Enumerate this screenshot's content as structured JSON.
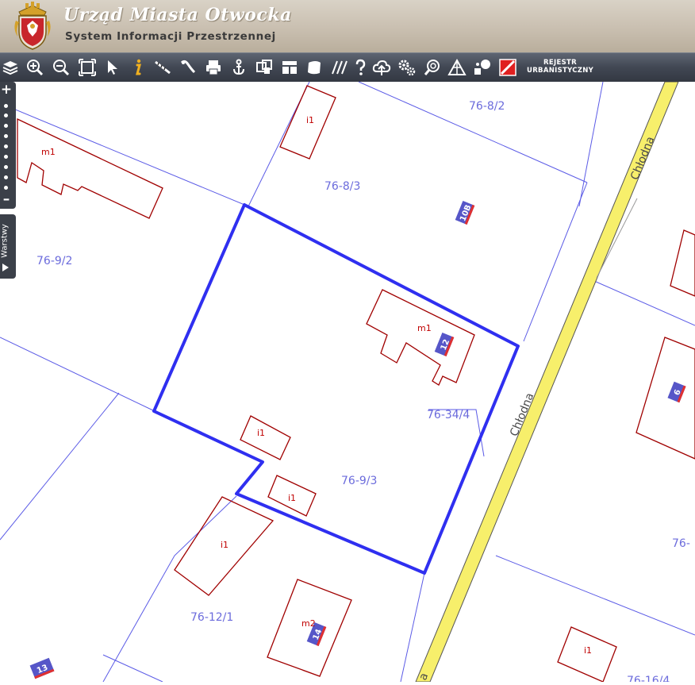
{
  "header": {
    "title": "Urząd Miasta Otwocka",
    "subtitle": "System Informacji Przestrzennej"
  },
  "toolbar": {
    "icons": [
      "layers-icon",
      "zoom-in-icon",
      "zoom-out-icon",
      "full-extent-icon",
      "select-arrow-icon",
      "info-icon",
      "measure-distance-icon",
      "measure-area-icon",
      "print-icon",
      "anchor-icon",
      "compare-icon",
      "layout-icon",
      "polygon-icon",
      "hatch-icon",
      "help-icon",
      "cloud-upload-icon",
      "settings-icon",
      "search-zoom-icon",
      "triangle-icon",
      "legend-icon",
      "red-square-icon"
    ],
    "registry_label": "REJESTR URBANISTYCZNY",
    "colors": {
      "header_bg": "#c9bfb0",
      "toolbar_bg": "#414753"
    }
  },
  "side": {
    "zoom_in": "+",
    "zoom_out": "–",
    "layers_tab_label": "Warstwy"
  },
  "map": {
    "colors": {
      "parcel_line": "#5a5ae6",
      "building_line": "#a00000",
      "highlight": "#2f2ff0",
      "road_fill": "#f7ef6b",
      "badge_fill": "#5656c8",
      "badge_stripe": "#e03030"
    },
    "parcels": [
      "76-8/2",
      "76-8/3",
      "76-9/2",
      "76-34/4",
      "76-9/3",
      "76-12/1",
      "76-",
      "76-16/4"
    ],
    "buildings": [
      "i1",
      "m1",
      "m1",
      "i1",
      "i1",
      "i1",
      "m2",
      "i1"
    ],
    "street": [
      "Chłodna",
      "Chłodna",
      "a"
    ],
    "house_numbers": [
      "10B",
      "12",
      "6",
      "14",
      "13"
    ]
  }
}
